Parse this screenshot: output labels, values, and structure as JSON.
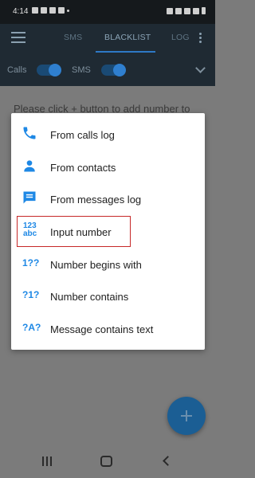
{
  "status_bar": {
    "time": "4:14"
  },
  "tabs": {
    "sms": "SMS",
    "blacklist": "BLACKLIST",
    "log": "LOG"
  },
  "filters": {
    "calls": "Calls",
    "sms": "SMS",
    "calls_enabled": true,
    "sms_enabled": true
  },
  "hint": "Please click + button to add number to",
  "dialog": {
    "options": [
      {
        "label": "From calls log",
        "icon": "phone-icon"
      },
      {
        "label": "From contacts",
        "icon": "person-icon"
      },
      {
        "label": "From messages log",
        "icon": "message-icon"
      },
      {
        "label": "Input number",
        "icon": "input-number-icon",
        "icon_top": "123",
        "icon_bottom": "abc"
      },
      {
        "label": "Number begins with",
        "icon": "begins-with-icon",
        "icon_text": "1??"
      },
      {
        "label": "Number contains",
        "icon": "contains-icon",
        "icon_text": "?1?"
      },
      {
        "label": "Message contains text",
        "icon": "message-text-icon",
        "icon_text": "?A?"
      }
    ]
  },
  "colors": {
    "accent": "#1e88e5",
    "app_bar": "#1f2a33",
    "highlight": "#c62828",
    "fab": "#1b5e94"
  }
}
